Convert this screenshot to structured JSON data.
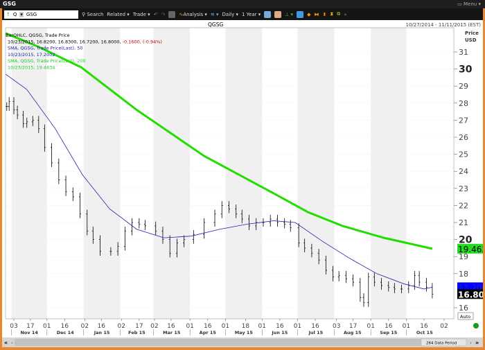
{
  "window": {
    "title": "GSG",
    "menu": "Menu"
  },
  "toolbar": {
    "symbol_prefix": "Q",
    "symbol": "GSG",
    "search": "Search",
    "related": "Related",
    "trade": "Trade",
    "analysis": "Analysis",
    "period": "Daily",
    "range": "1 Year"
  },
  "chart": {
    "title": "QGSG",
    "date_range": "10/27/2014 - 11/11/2015 (EST)",
    "axis_title": [
      "Price",
      "USD"
    ],
    "auto": "Auto",
    "data_period": "264 Data Period",
    "legend": [
      {
        "text": "BarOHLC, QGSG, Trade Price",
        "color": "#000000"
      },
      {
        "text": "10/23/2015, 16.8200, 16.8300, 16.7200, 16.8000,",
        "color": "#000000",
        "extra": " -0.1600, (-0.94%)",
        "extra_color": "#cc0000"
      },
      {
        "text": "SMA, QGSG, Trade Price(Last),  50",
        "color": "#2222aa"
      },
      {
        "text": "10/23/2015, 17.2002",
        "color": "#2222aa"
      },
      {
        "text": "SMA, QGSG, Trade Price(Last),  200",
        "color": "#22cc22"
      },
      {
        "text": "10/23/2015, 19.4634",
        "color": "#22cc22"
      }
    ],
    "y_ticks": [
      {
        "v": 31
      },
      {
        "v": 30,
        "bold": true
      },
      {
        "v": 29
      },
      {
        "v": 28
      },
      {
        "v": 27
      },
      {
        "v": 26
      },
      {
        "v": 25
      },
      {
        "v": 24
      },
      {
        "v": 23
      },
      {
        "v": 22
      },
      {
        "v": 21
      },
      {
        "v": 20,
        "bold": true
      },
      {
        "v": 19
      },
      {
        "v": 18
      },
      {
        "v": 16
      }
    ],
    "price_tags": [
      {
        "label": "19.463",
        "value": 19.4634,
        "bg": "#22dd22",
        "fg": "#000"
      },
      {
        "label": "17.200",
        "value": 17.2002,
        "bg": "#0000ff",
        "fg": "#2222aa"
      },
      {
        "label": "16.80",
        "value": 16.8,
        "bg": "#000000",
        "fg": "#ffffff"
      }
    ],
    "x_day_ticks": [
      [
        "2014-11-03",
        "03"
      ],
      [
        "2014-11-17",
        "17"
      ],
      [
        "2014-12-01",
        "01"
      ],
      [
        "2014-12-16",
        "16"
      ],
      [
        "2015-01-02",
        "02"
      ],
      [
        "2015-01-16",
        "16"
      ],
      [
        "2015-02-02",
        "02"
      ],
      [
        "2015-02-17",
        "17"
      ],
      [
        "2015-03-02",
        "02"
      ],
      [
        "2015-03-16",
        "16"
      ],
      [
        "2015-04-01",
        "01"
      ],
      [
        "2015-04-16",
        "16"
      ],
      [
        "2015-05-01",
        "01"
      ],
      [
        "2015-05-18",
        "18"
      ],
      [
        "2015-06-01",
        "01"
      ],
      [
        "2015-06-16",
        "16"
      ],
      [
        "2015-07-01",
        "01"
      ],
      [
        "2015-07-16",
        "16"
      ],
      [
        "2015-08-03",
        "03"
      ],
      [
        "2015-08-17",
        "17"
      ],
      [
        "2015-09-01",
        "01"
      ],
      [
        "2015-09-16",
        "16"
      ],
      [
        "2015-10-01",
        "01"
      ],
      [
        "2015-10-16",
        "16"
      ],
      [
        "2015-11-02",
        "02"
      ]
    ],
    "x_months": [
      "Nov 14",
      "Dec 14",
      "Jan 15",
      "Feb 15",
      "Mar 15",
      "Apr 15",
      "May 15",
      "Jun 15",
      "Jul 15",
      "Aug 15",
      "Sep 15",
      "Oct 15"
    ],
    "colors": {
      "bars": "#000000",
      "sma50": "#2222aa",
      "sma200": "#22dd00"
    }
  },
  "chart_data": {
    "type": "ohlc",
    "x_range": [
      "2014-10-27",
      "2015-11-11"
    ],
    "y_range": [
      15.5,
      32.5
    ],
    "closes": [
      [
        "2014-10-28",
        27.8
      ],
      [
        "2014-10-30",
        28.1
      ],
      [
        "2014-11-03",
        27.6
      ],
      [
        "2014-11-06",
        27.3
      ],
      [
        "2014-11-11",
        26.8
      ],
      [
        "2014-11-14",
        26.9
      ],
      [
        "2014-11-19",
        27.0
      ],
      [
        "2014-11-24",
        26.5
      ],
      [
        "2014-11-29",
        25.4
      ],
      [
        "2014-12-05",
        24.5
      ],
      [
        "2014-12-11",
        23.5
      ],
      [
        "2014-12-17",
        22.8
      ],
      [
        "2014-12-23",
        22.5
      ],
      [
        "2014-12-29",
        21.5
      ],
      [
        "2015-01-04",
        20.5
      ],
      [
        "2015-01-09",
        20.0
      ],
      [
        "2015-01-15",
        19.3
      ],
      [
        "2015-01-24",
        19.3
      ],
      [
        "2015-01-30",
        19.6
      ],
      [
        "2015-02-05",
        20.5
      ],
      [
        "2015-02-11",
        21.0
      ],
      [
        "2015-02-17",
        20.9
      ],
      [
        "2015-02-22",
        20.8
      ],
      [
        "2015-03-03",
        20.5
      ],
      [
        "2015-03-09",
        20.0
      ],
      [
        "2015-03-15",
        19.2
      ],
      [
        "2015-03-21",
        19.8
      ],
      [
        "2015-03-27",
        20.0
      ],
      [
        "2015-04-04",
        20.3
      ],
      [
        "2015-04-13",
        21.0
      ],
      [
        "2015-04-22",
        21.5
      ],
      [
        "2015-04-28",
        22.0
      ],
      [
        "2015-05-04",
        21.8
      ],
      [
        "2015-05-10",
        21.5
      ],
      [
        "2015-05-15",
        21.2
      ],
      [
        "2015-05-21",
        20.8
      ],
      [
        "2015-05-27",
        21.0
      ],
      [
        "2015-06-02",
        21.0
      ],
      [
        "2015-06-08",
        21.2
      ],
      [
        "2015-06-14",
        21.0
      ],
      [
        "2015-06-20",
        20.9
      ],
      [
        "2015-06-25",
        20.7
      ],
      [
        "2015-07-02",
        19.8
      ],
      [
        "2015-07-07",
        19.5
      ],
      [
        "2015-07-13",
        19.2
      ],
      [
        "2015-07-19",
        18.8
      ],
      [
        "2015-07-25",
        18.2
      ],
      [
        "2015-07-31",
        17.8
      ],
      [
        "2015-08-05",
        17.9
      ],
      [
        "2015-08-11",
        17.7
      ],
      [
        "2015-08-17",
        17.5
      ],
      [
        "2015-08-23",
        16.6
      ],
      [
        "2015-08-26",
        16.3
      ],
      [
        "2015-08-30",
        17.8
      ],
      [
        "2015-09-04",
        17.5
      ],
      [
        "2015-09-10",
        17.3
      ],
      [
        "2015-09-16",
        17.2
      ],
      [
        "2015-09-21",
        17.1
      ],
      [
        "2015-09-27",
        17.1
      ],
      [
        "2015-10-03",
        17.3
      ],
      [
        "2015-10-08",
        17.9
      ],
      [
        "2015-10-12",
        17.5
      ],
      [
        "2015-10-18",
        17.2
      ],
      [
        "2015-10-23",
        16.8
      ]
    ],
    "sma50": [
      [
        "2014-10-27",
        29.7
      ],
      [
        "2014-11-14",
        28.8
      ],
      [
        "2014-12-08",
        26.5
      ],
      [
        "2014-12-31",
        23.8
      ],
      [
        "2015-01-23",
        21.8
      ],
      [
        "2015-02-15",
        20.6
      ],
      [
        "2015-03-10",
        20.1
      ],
      [
        "2015-04-02",
        20.2
      ],
      [
        "2015-04-26",
        20.6
      ],
      [
        "2015-05-19",
        20.9
      ],
      [
        "2015-06-11",
        21.1
      ],
      [
        "2015-06-29",
        21.0
      ],
      [
        "2015-07-22",
        19.9
      ],
      [
        "2015-08-14",
        18.9
      ],
      [
        "2015-09-06",
        18.0
      ],
      [
        "2015-09-29",
        17.4
      ],
      [
        "2015-10-16",
        17.1
      ],
      [
        "2015-10-23",
        17.2
      ]
    ],
    "sma200": [
      [
        "2014-10-27",
        32.1
      ],
      [
        "2014-11-24",
        31.3
      ],
      [
        "2014-12-30",
        30.1
      ],
      [
        "2015-02-15",
        27.6
      ],
      [
        "2015-04-13",
        24.9
      ],
      [
        "2015-06-11",
        22.7
      ],
      [
        "2015-07-10",
        21.6
      ],
      [
        "2015-08-08",
        20.8
      ],
      [
        "2015-09-12",
        20.1
      ],
      [
        "2015-10-23",
        19.46
      ]
    ]
  }
}
